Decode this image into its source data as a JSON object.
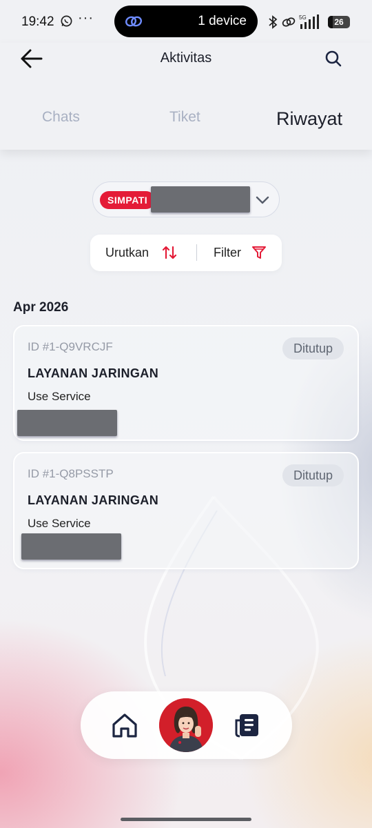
{
  "status_bar": {
    "time": "19:42",
    "pill_text": "1 device",
    "battery": "26",
    "network": "5G"
  },
  "header": {
    "title": "Aktivitas",
    "back_icon": "arrow-left-icon",
    "search_icon": "search-icon"
  },
  "tabs": [
    {
      "label": "Chats",
      "active": false
    },
    {
      "label": "Tiket",
      "active": false
    },
    {
      "label": "Riwayat",
      "active": true
    }
  ],
  "account": {
    "badge": "SIMPATI"
  },
  "controls": {
    "sort_label": "Urutkan",
    "filter_label": "Filter"
  },
  "history": {
    "month": "Apr 2026",
    "tickets": [
      {
        "id": "ID #1-Q9VRCJF",
        "status": "Ditutup",
        "title": "LAYANAN JARINGAN",
        "subtitle": "Use Service"
      },
      {
        "id": "ID #1-Q8PSSTP",
        "status": "Ditutup",
        "title": "LAYANAN JARINGAN",
        "subtitle": "Use Service"
      }
    ]
  },
  "bottom_nav": {
    "items": [
      "home-icon",
      "assistant-avatar",
      "newspaper-icon"
    ]
  },
  "colors": {
    "accent_red": "#e41b37",
    "navy": "#1c2541",
    "text_dark": "#1c1f2a",
    "tab_inactive": "#a8b0c2"
  }
}
